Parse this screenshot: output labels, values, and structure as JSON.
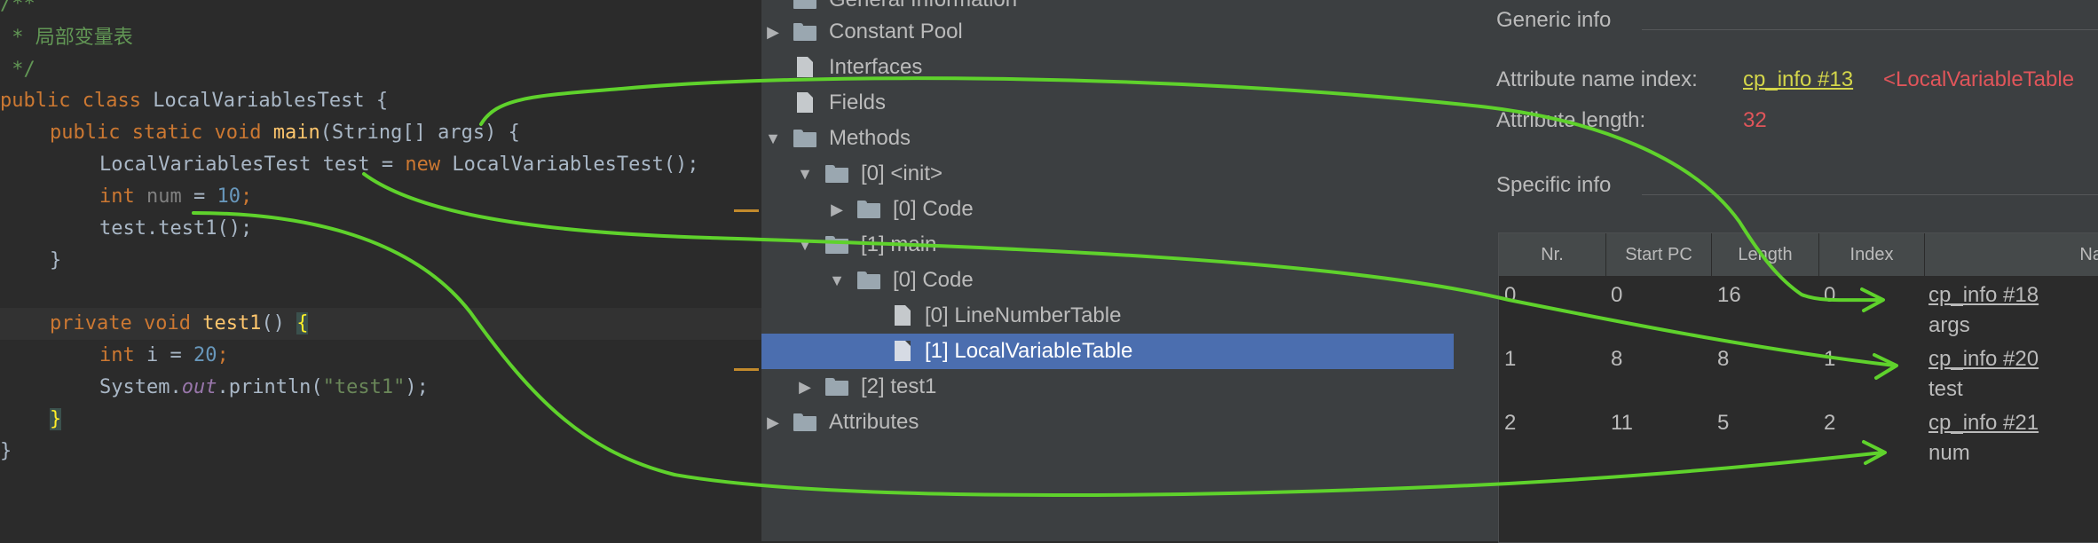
{
  "code": {
    "line_comment_open": "/**",
    "line_comment_body": " * 局部变量表",
    "line_comment_close": " */",
    "kw_public": "public",
    "kw_class": "class",
    "class_name": "LocalVariablesTest",
    "open_brace": "{",
    "kw_static": "static",
    "kw_void": "void",
    "method_main": "main",
    "main_params": "(String[] ",
    "param_args": "args",
    "main_params_close": ") {",
    "decl_type": "LocalVariablesTest ",
    "var_test": "test",
    "assign": " = ",
    "kw_new": "new",
    "ctor_call": " LocalVariablesTest();",
    "kw_int": "int",
    "var_num": "num",
    "assign2": " = ",
    "num_10": "10",
    "semi": ";",
    "call_test1": "test.test1();",
    "close_brace": "}",
    "kw_private": "private",
    "method_test1": "test1",
    "parens": "() ",
    "var_i": "i",
    "num_20": "20",
    "sys": "System.",
    "out_field": "out",
    "println": ".println(",
    "str_test1": "\"test1\"",
    "println_close": ");"
  },
  "tree": {
    "items": [
      {
        "label": "General Information"
      },
      {
        "label": "Constant Pool"
      },
      {
        "label": "Interfaces"
      },
      {
        "label": "Fields"
      },
      {
        "label": "Methods"
      },
      {
        "label": "[0] <init>"
      },
      {
        "label": "[0] Code"
      },
      {
        "label": "[1] main"
      },
      {
        "label": "[0] Code"
      },
      {
        "label": "[0] LineNumberTable"
      },
      {
        "label": "[1] LocalVariableTable"
      },
      {
        "label": "[2] test1"
      },
      {
        "label": "Attributes"
      }
    ]
  },
  "info": {
    "generic_info": "Generic info",
    "attr_name_index_label": "Attribute name index:",
    "attr_name_index_link": "cp_info #13",
    "attr_name_index_value": "<LocalVariableTable",
    "attr_length_label": "Attribute length:",
    "attr_length_value": "32",
    "specific_info": "Specific info",
    "columns": [
      "Nr.",
      "Start PC",
      "Length",
      "Index",
      "Na"
    ],
    "rows": [
      {
        "nr": "0",
        "start_pc": "0",
        "length": "16",
        "index": "0",
        "name_link": "cp_info #18",
        "name": "args"
      },
      {
        "nr": "1",
        "start_pc": "8",
        "length": "8",
        "index": "1",
        "name_link": "cp_info #20",
        "name": "test"
      },
      {
        "nr": "2",
        "start_pc": "11",
        "length": "5",
        "index": "2",
        "name_link": "cp_info #21",
        "name": "num"
      }
    ]
  },
  "colors": {
    "annotation": "#5fd22c",
    "selection": "#4b6eaf",
    "link": "#d4d64a",
    "value_red": "#e0555a"
  }
}
